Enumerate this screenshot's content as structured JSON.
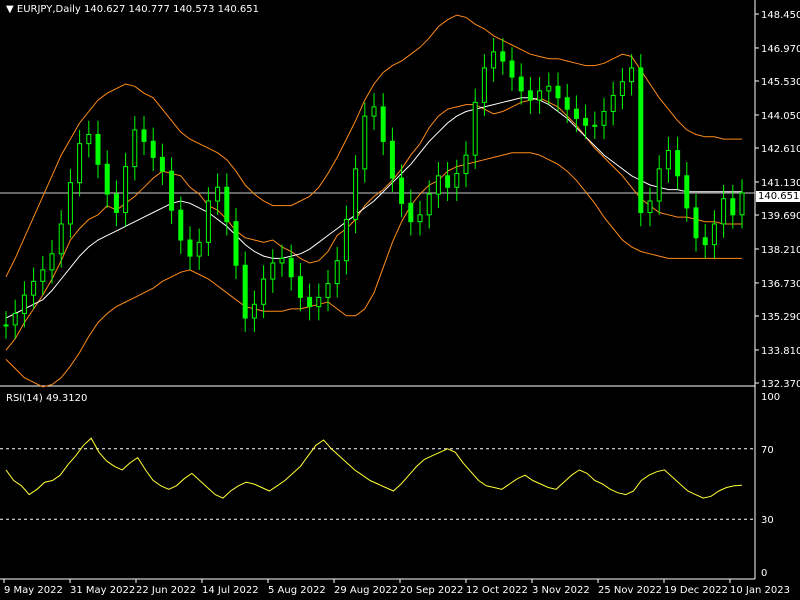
{
  "header": {
    "title": "EURJPY,Daily",
    "ohlc": "140.627 140.777 140.573 140.651"
  },
  "rsi": {
    "title": "RSI(14) 49.3120",
    "levels": [
      100,
      70,
      30,
      0
    ]
  },
  "current_price": "140.651",
  "colors": {
    "candle": "#00ff00",
    "bands": "#ff8c1a",
    "ma": "#ffffff",
    "rsi": "#ffff33",
    "grid": "#ffffff"
  },
  "chart_data": [
    {
      "type": "line",
      "title": "EURJPY,Daily",
      "y_ticks": [
        "148.450",
        "146.970",
        "145.530",
        "144.050",
        "142.610",
        "141.130",
        "139.690",
        "138.210",
        "136.730",
        "135.290",
        "133.810",
        "132.370"
      ],
      "x_ticks": [
        "9 May 2022",
        "31 May 2022",
        "22 Jun 2022",
        "14 Jul 2022",
        "5 Aug 2022",
        "29 Aug 2022",
        "20 Sep 2022",
        "12 Oct 2022",
        "3 Nov 2022",
        "25 Nov 2022",
        "19 Dec 2022",
        "10 Jan 2023"
      ],
      "ylim": [
        132.37,
        148.45
      ],
      "series": [
        {
          "values": [
            134.9,
            135.4,
            136.2,
            136.8,
            137.3,
            138.0,
            139.3,
            141.1,
            142.8,
            143.2,
            141.9,
            140.6,
            139.8,
            141.8,
            143.4,
            142.9,
            142.2,
            141.6,
            139.9,
            138.6,
            137.9,
            138.5,
            140.3,
            140.9,
            139.4,
            137.5,
            135.2,
            135.8,
            136.9,
            137.6,
            137.8,
            137.0,
            136.1,
            135.7,
            136.1,
            136.7,
            137.7,
            139.5,
            141.7,
            144.0,
            144.4,
            142.9,
            141.3,
            140.2,
            139.4,
            139.7,
            140.6,
            141.4,
            140.9,
            141.5,
            142.3,
            144.6,
            146.1,
            146.8,
            146.4,
            145.7,
            145.1,
            144.7,
            145.1,
            145.3,
            144.8,
            144.3,
            143.9,
            143.6,
            143.6,
            144.2,
            144.9,
            145.5,
            146.1,
            139.8,
            140.3,
            141.7,
            142.5,
            141.4,
            140.0,
            138.7,
            138.4,
            139.3,
            140.4,
            139.7,
            140.651
          ]
        },
        {
          "values": [
            133.8,
            134.3,
            135.0,
            135.6,
            136.2,
            136.9,
            137.7,
            138.6,
            139.1,
            139.5,
            139.7,
            140.1,
            139.9,
            140.2,
            140.5,
            140.9,
            141.3,
            141.6,
            141.5,
            141.4,
            140.9,
            140.6,
            140.1,
            139.9,
            139.5,
            139.0,
            138.7,
            138.6,
            138.5,
            138.6,
            138.3,
            138.1,
            137.8,
            137.6,
            137.7,
            138.1,
            138.8,
            139.1,
            139.5,
            140.1,
            140.5,
            140.8,
            141.2,
            141.7,
            142.3,
            142.8,
            143.5,
            144.0,
            144.3,
            144.4,
            144.5,
            144.5,
            144.3,
            144.1,
            144.2,
            144.4,
            144.6,
            144.7,
            144.8,
            144.6,
            144.4,
            144.0,
            143.6,
            143.1,
            142.6,
            142.2,
            141.8,
            141.4,
            140.9,
            140.4,
            140.1,
            139.8,
            139.7,
            139.6,
            139.6,
            139.5,
            139.4,
            139.4,
            139.3,
            139.3,
            139.3
          ]
        },
        {
          "values": [
            135.2,
            135.4,
            135.6,
            135.8,
            136.0,
            136.4,
            136.9,
            137.4,
            137.9,
            138.3,
            138.6,
            138.8,
            139.0,
            139.2,
            139.4,
            139.6,
            139.8,
            140.0,
            140.2,
            140.3,
            140.2,
            140.0,
            139.8,
            139.5,
            139.2,
            138.8,
            138.4,
            138.1,
            137.9,
            137.8,
            137.8,
            137.9,
            138.0,
            138.2,
            138.5,
            138.8,
            139.1,
            139.4,
            139.7,
            140.0,
            140.3,
            140.7,
            141.1,
            141.5,
            141.9,
            142.4,
            142.9,
            143.3,
            143.7,
            144.0,
            144.2,
            144.3,
            144.4,
            144.5,
            144.6,
            144.7,
            144.8,
            144.8,
            144.7,
            144.5,
            144.2,
            143.9,
            143.5,
            143.1,
            142.7,
            142.3,
            142.0,
            141.7,
            141.4,
            141.2,
            141.0,
            140.9,
            140.8,
            140.8,
            140.7,
            140.7,
            140.7,
            140.7,
            140.7,
            140.7,
            140.7
          ]
        },
        {
          "values": [
            137.0,
            137.8,
            138.7,
            139.6,
            140.5,
            141.4,
            142.3,
            143.0,
            143.7,
            144.2,
            144.7,
            145.0,
            145.2,
            145.4,
            145.3,
            145.0,
            144.8,
            144.3,
            143.8,
            143.3,
            143.0,
            142.8,
            142.6,
            142.4,
            142.1,
            141.6,
            141.0,
            140.6,
            140.3,
            140.1,
            140.1,
            140.1,
            140.3,
            140.5,
            140.9,
            141.5,
            142.2,
            143.0,
            143.8,
            144.7,
            145.4,
            145.9,
            146.2,
            146.4,
            146.7,
            147.0,
            147.4,
            147.9,
            148.2,
            148.4,
            148.3,
            148.0,
            147.8,
            147.5,
            147.3,
            147.1,
            146.9,
            146.7,
            146.6,
            146.5,
            146.5,
            146.4,
            146.3,
            146.2,
            146.2,
            146.3,
            146.5,
            146.7,
            146.6,
            146.0,
            145.4,
            144.8,
            144.3,
            143.8,
            143.4,
            143.2,
            143.1,
            143.1,
            143.0,
            143.0,
            143.0
          ]
        },
        {
          "values": [
            133.4,
            133.0,
            132.6,
            132.4,
            132.2,
            132.3,
            132.6,
            133.1,
            133.7,
            134.4,
            135.0,
            135.4,
            135.7,
            135.9,
            136.1,
            136.3,
            136.5,
            136.8,
            137.0,
            137.2,
            137.3,
            137.1,
            136.9,
            136.6,
            136.3,
            136.0,
            135.7,
            135.6,
            135.5,
            135.5,
            135.5,
            135.6,
            135.6,
            135.7,
            135.8,
            135.9,
            135.6,
            135.3,
            135.3,
            135.6,
            136.3,
            137.4,
            138.5,
            139.4,
            140.1,
            140.6,
            141.0,
            141.2,
            141.6,
            141.8,
            141.9,
            142.0,
            142.1,
            142.2,
            142.3,
            142.4,
            142.4,
            142.4,
            142.3,
            142.1,
            141.9,
            141.6,
            141.2,
            140.7,
            140.2,
            139.6,
            139.1,
            138.6,
            138.3,
            138.1,
            138.0,
            137.9,
            137.8,
            137.8,
            137.8,
            137.8,
            137.8,
            137.8,
            137.8,
            137.8,
            137.8
          ]
        }
      ]
    },
    {
      "type": "line",
      "title": "RSI(14) 49.3120",
      "ylim": [
        0,
        100
      ],
      "y_ticks": [
        "100",
        "70",
        "30",
        "0"
      ],
      "levels": [
        70,
        30
      ],
      "values": [
        58,
        52,
        49,
        44,
        47,
        51,
        52,
        55,
        61,
        66,
        72,
        76,
        68,
        63,
        60,
        58,
        62,
        65,
        58,
        52,
        49,
        47,
        49,
        53,
        56,
        52,
        48,
        44,
        42,
        46,
        49,
        51,
        50,
        48,
        46,
        49,
        52,
        56,
        60,
        66,
        72,
        75,
        70,
        66,
        62,
        58,
        55,
        52,
        50,
        48,
        46,
        50,
        55,
        60,
        64,
        66,
        68,
        70,
        68,
        62,
        57,
        52,
        49,
        48,
        47,
        50,
        53,
        55,
        52,
        50,
        48,
        47,
        51,
        55,
        58,
        56,
        52,
        50,
        47,
        45,
        44,
        46,
        52,
        55,
        57,
        58,
        54,
        50,
        46,
        44,
        42,
        43,
        46,
        48,
        49,
        49.312
      ]
    }
  ]
}
